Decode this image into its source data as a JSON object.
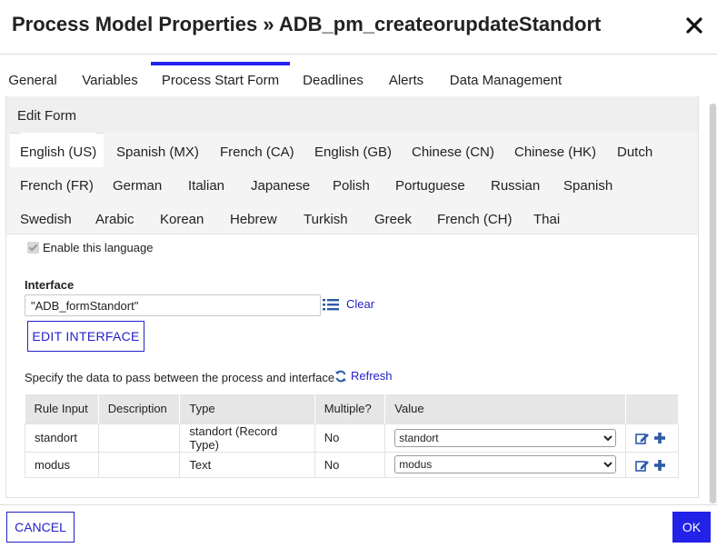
{
  "dialog": {
    "title": "Process Model Properties » ADB_pm_createorupdateStandort",
    "close_icon": "close-x-icon"
  },
  "tabs": [
    {
      "label": "General"
    },
    {
      "label": "Variables"
    },
    {
      "label": "Process Start Form",
      "active": true
    },
    {
      "label": "Deadlines"
    },
    {
      "label": "Alerts"
    },
    {
      "label": "Data Management"
    }
  ],
  "panel": {
    "header": "Edit Form"
  },
  "languages": {
    "row1": [
      "English (US)",
      "Spanish (MX)",
      "French (CA)",
      "English (GB)",
      "Chinese (CN)",
      "Chinese (HK)",
      "Dutch"
    ],
    "row2": [
      "French (FR)",
      "German",
      "Italian",
      "Japanese",
      "Polish",
      "Portuguese",
      "Russian",
      "Spanish"
    ],
    "row3": [
      "Swedish",
      "Arabic",
      "Korean",
      "Hebrew",
      "Turkish",
      "Greek",
      "French (CH)",
      "Thai"
    ],
    "active": "English (US)"
  },
  "enable_language": {
    "label": "Enable this language",
    "checked": true
  },
  "interface": {
    "label": "Interface",
    "value": "\"ADB_formStandort\"",
    "clear_label": "Clear",
    "edit_button": "EDIT INTERFACE"
  },
  "data_section": {
    "text": "Specify the data to pass between the process and interface",
    "refresh_label": "Refresh"
  },
  "table": {
    "headers": [
      "Rule Input",
      "Description",
      "Type",
      "Multiple?",
      "Value"
    ],
    "rows": [
      {
        "rule_input": "standort",
        "description": "",
        "type": "standort (Record Type)",
        "multiple": "No",
        "value": "standort"
      },
      {
        "rule_input": "modus",
        "description": "",
        "type": "Text",
        "multiple": "No",
        "value": "modus"
      }
    ]
  },
  "footer": {
    "cancel_label": "CANCEL",
    "ok_label": "OK"
  },
  "colors": {
    "accent": "#2322e8",
    "link": "#2322c8",
    "header_bg": "#efefef"
  }
}
